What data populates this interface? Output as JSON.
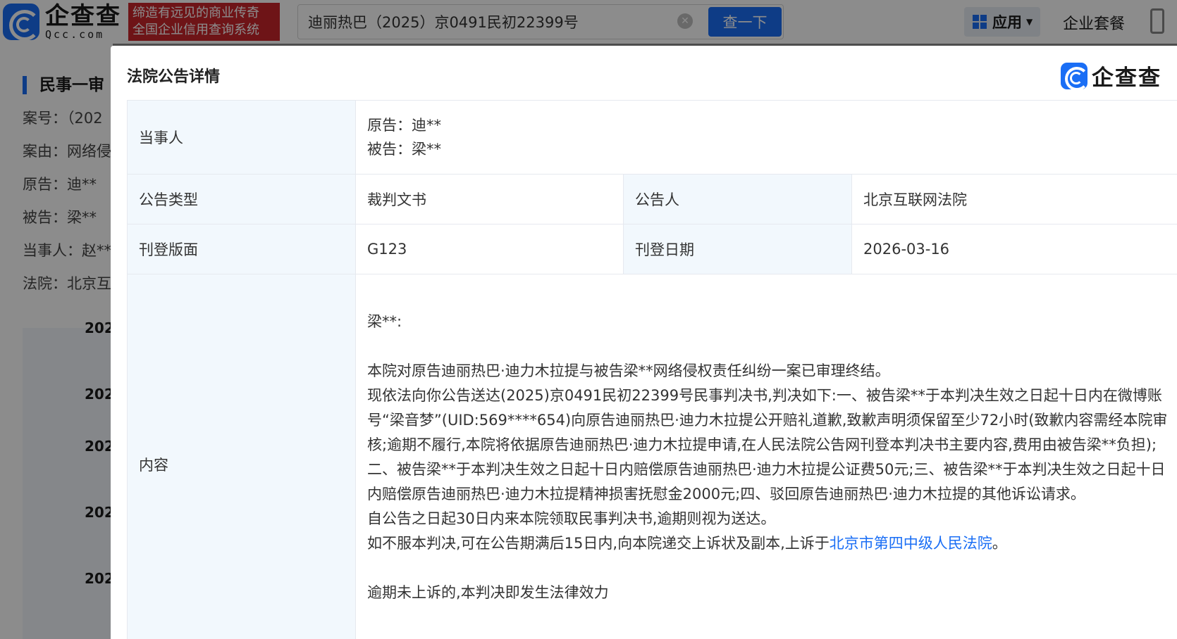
{
  "header": {
    "logo_cn": "企查查",
    "logo_en": "Qcc.com",
    "slogan_line1": "缔造有远见的商业传奇",
    "slogan_line2": "全国企业信用查询系统",
    "search_value": "迪丽热巴（2025）京0491民初22399号",
    "search_button": "查一下",
    "apps_label": "应用",
    "plan_link": "企业套餐"
  },
  "background_panel": {
    "title": "民事一审",
    "lines": [
      "案号：（202",
      "案由：网络侵",
      "原告：迪**",
      "被告：梁**",
      "当事人：赵**",
      "法院：北京互"
    ],
    "years": [
      "202",
      "202",
      "202",
      "202",
      "202"
    ]
  },
  "modal": {
    "title": "法院公告详情",
    "brand": "企查查",
    "party": {
      "label": "当事人",
      "plaintiff": "原告：迪**",
      "defendant": "被告：梁**"
    },
    "notice_type": {
      "label": "公告类型",
      "value": "裁判文书"
    },
    "announcer": {
      "label": "公告人",
      "value": "北京互联网法院"
    },
    "page": {
      "label": "刊登版面",
      "value": "G123"
    },
    "date": {
      "label": "刊登日期",
      "value": "2026-03-16"
    },
    "content": {
      "label": "内容",
      "salutation": "梁**:",
      "para1": "本院对原告迪丽热巴·迪力木拉提与被告梁**网络侵权责任纠纷一案已审理终结。",
      "para2": "现依法向你公告送达(2025)京0491民初22399号民事判决书,判决如下:一、被告梁**于本判决生效之日起十日内在微博账号“梁音梦”(UID:569****654)向原告迪丽热巴·迪力木拉提公开赔礼道歉,致歉声明须保留至少72小时(致歉内容需经本院审核;逾期不履行,本院将依据原告迪丽热巴·迪力木拉提申请,在人民法院公告网刊登本判决书主要内容,费用由被告梁**负担);二、被告梁**于本判决生效之日起十日内赔偿原告迪丽热巴·迪力木拉提公证费50元;三、被告梁**于本判决生效之日起十日内赔偿原告迪丽热巴·迪力木拉提精神损害抚慰金2000元;四、驳回原告迪丽热巴·迪力木拉提的其他诉讼请求。",
      "para3": "自公告之日起30日内来本院领取民事判决书,逾期则视为送达。",
      "para4_prefix": "如不服本判决,可在公告期满后15日内,向本院递交上诉状及副本,上诉于",
      "para4_link": "北京市第四中级人民法院",
      "para4_suffix": "。",
      "para5": "逾期未上诉的,本判决即发生法律效力"
    }
  },
  "colors": {
    "accent": "#1a6ef5",
    "slogan_bg": "#c9252b",
    "label_bg": "#f2f8fd"
  }
}
